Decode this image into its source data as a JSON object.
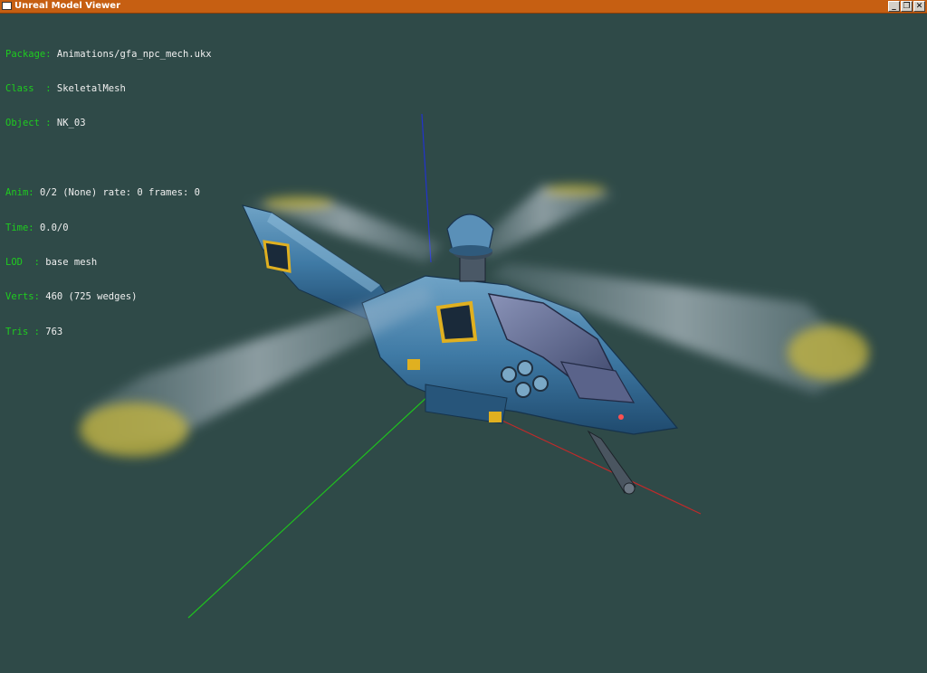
{
  "window": {
    "title": "Unreal Model Viewer",
    "buttons": {
      "minimize": "_",
      "maximize": "❐",
      "close": "✕"
    }
  },
  "info": {
    "package": {
      "label": "Package:",
      "value": "Animations/gfa_npc_mech.ukx"
    },
    "class": {
      "label": "Class  :",
      "value": "SkeletalMesh"
    },
    "object": {
      "label": "Object :",
      "value": "NK_03"
    },
    "anim": {
      "label": "Anim:",
      "value": "0/2 (None) rate: 0 frames: 0"
    },
    "time": {
      "label": "Time:",
      "value": "0.0/0"
    },
    "lod": {
      "label": "LOD  :",
      "value": "base mesh"
    },
    "verts": {
      "label": "Verts:",
      "value": "460 (725 wedges)"
    },
    "tris": {
      "label": "Tris :",
      "value": "763"
    }
  },
  "colors": {
    "viewport_bg": "#2f4a48",
    "titlebar": "#c65f12",
    "label_green": "#1fcc1f",
    "value_white": "#f0f0f0",
    "axis_x": "#c02a2a",
    "axis_y": "#1fbf1f",
    "axis_z": "#2233cc"
  },
  "model": {
    "name": "helicopter-mesh"
  }
}
